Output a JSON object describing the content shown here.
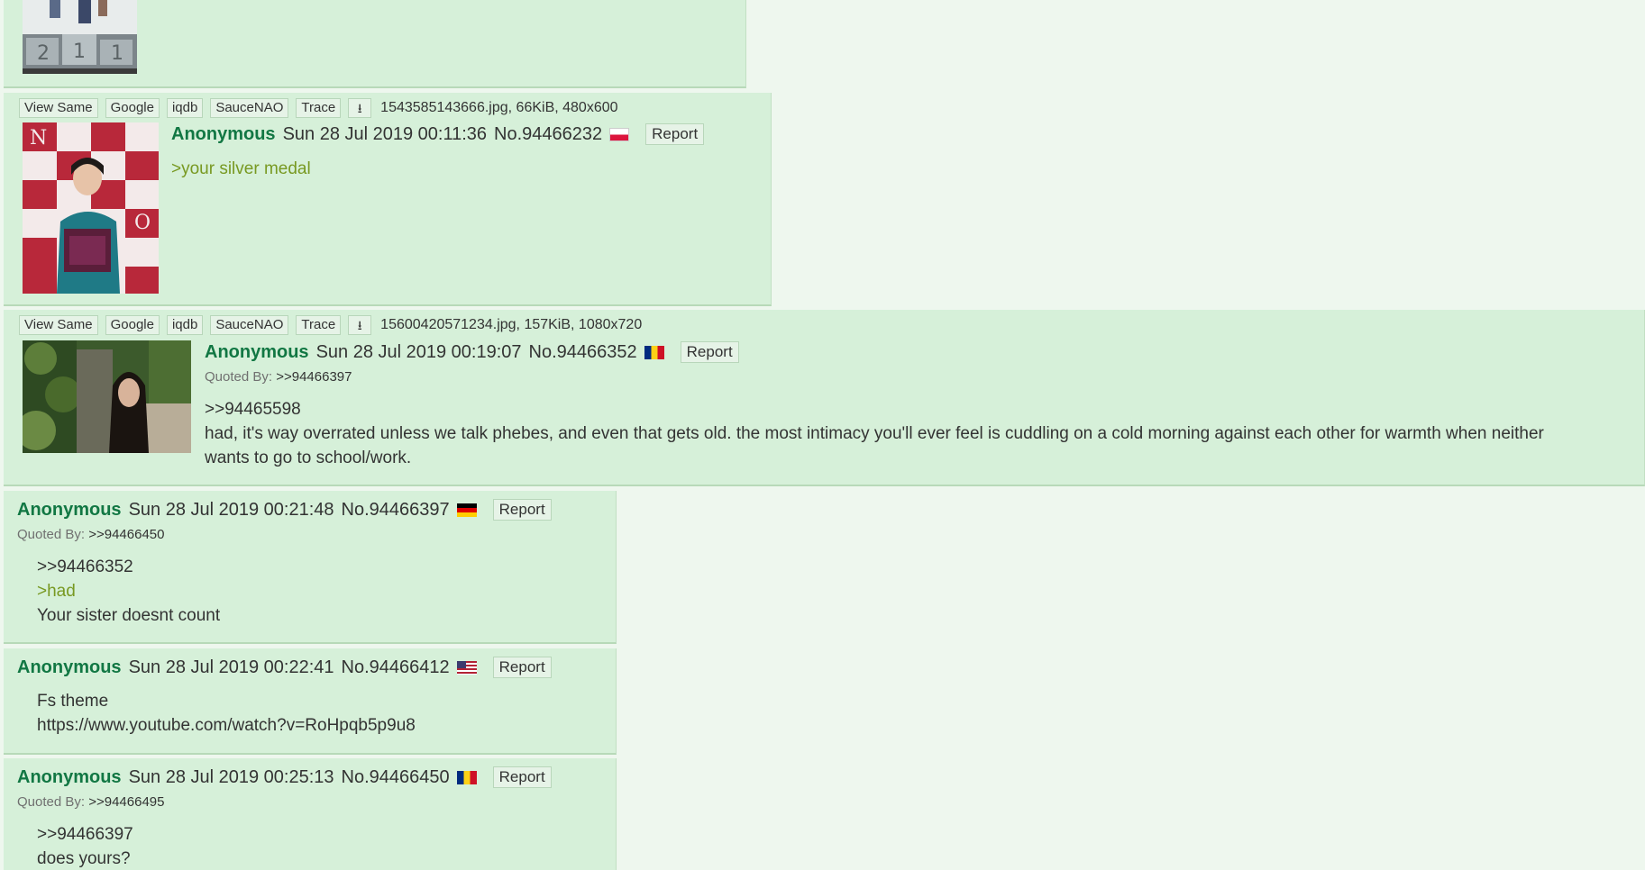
{
  "toolbar_buttons": [
    "View Same",
    "Google",
    "iqdb",
    "SauceNAO",
    "Trace"
  ],
  "top_post": {},
  "post1": {
    "file": "1543585143666.jpg, 66KiB, 480x600",
    "name": "Anonymous",
    "datetime": "Sun 28 Jul 2019 00:11:36",
    "no": "No.94466232",
    "flag": "poland-flag",
    "report": "Report",
    "lines": [
      ">your silver medal"
    ]
  },
  "post2": {
    "file": "15600420571234.jpg, 157KiB, 1080x720",
    "name": "Anonymous",
    "datetime": "Sun 28 Jul 2019 00:19:07",
    "no": "No.94466352",
    "flag": "romania-flag",
    "report": "Report",
    "quoted_label": "Quoted By:",
    "quoted_link": ">>94466397",
    "lines": [
      ">>94465598",
      "had, it's way overrated unless we talk phebes, and even that gets old. the most intimacy you'll ever feel is cuddling on a cold morning against each other for warmth when neither",
      "wants to go to school/work."
    ]
  },
  "post3": {
    "name": "Anonymous",
    "datetime": "Sun 28 Jul 2019 00:21:48",
    "no": "No.94466397",
    "flag": "germany-flag",
    "report": "Report",
    "quoted_label": "Quoted By:",
    "quoted_link": ">>94466450",
    "lines": [
      ">>94466352",
      ">had",
      "Your sister doesnt count"
    ]
  },
  "post4": {
    "name": "Anonymous",
    "datetime": "Sun 28 Jul 2019 00:22:41",
    "no": "No.94466412",
    "flag": "usa-flag",
    "report": "Report",
    "lines": [
      "Fs theme",
      "https://www.youtube.com/watch?v=RoHpqb5p9u8"
    ]
  },
  "post5": {
    "name": "Anonymous",
    "datetime": "Sun 28 Jul 2019 00:25:13",
    "no": "No.94466450",
    "flag": "romania-flag",
    "report": "Report",
    "quoted_label": "Quoted By:",
    "quoted_link": ">>94466495",
    "lines": [
      ">>94466397",
      "does yours?"
    ]
  },
  "colors": {
    "page_bg": "#eef7ee",
    "post_bg": "#d6f0d9",
    "name": "#117743",
    "greentext": "#789922"
  }
}
